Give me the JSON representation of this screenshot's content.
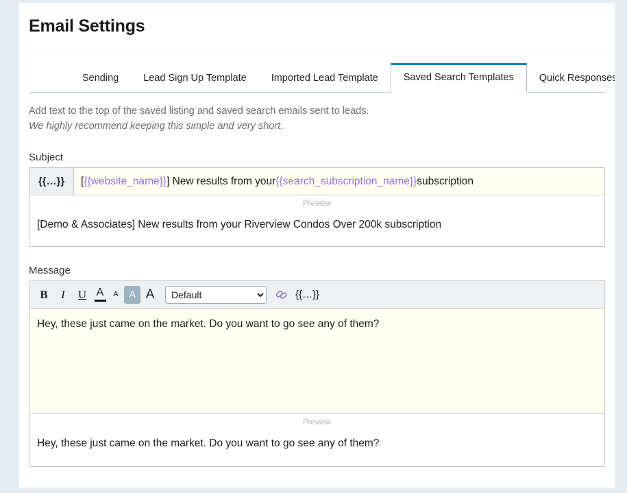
{
  "page": {
    "title": "Email Settings"
  },
  "tabs": [
    {
      "label": "Sending",
      "active": false
    },
    {
      "label": "Lead Sign Up Template",
      "active": false
    },
    {
      "label": "Imported Lead Template",
      "active": false
    },
    {
      "label": "Saved Search Templates",
      "active": true
    },
    {
      "label": "Quick Responses",
      "active": false
    }
  ],
  "description": {
    "line1": "Add text to the top of the saved listing and saved search emails sent to leads.",
    "line2": "We highly recommend keeping this simple and very short."
  },
  "subject": {
    "label": "Subject",
    "merge_button": "{{…}}",
    "value_parts": [
      {
        "text": "[",
        "token": false
      },
      {
        "text": "{{website_name}}",
        "token": true
      },
      {
        "text": "] New results from your ",
        "token": false
      },
      {
        "text": "{{search_subscription_name}}",
        "token": true
      },
      {
        "text": " subscription",
        "token": false
      }
    ],
    "preview_label": "Preview",
    "preview_value": "[Demo & Associates] New results from your Riverview Condos Over 200k subscription"
  },
  "message": {
    "label": "Message",
    "toolbar": {
      "bold": "B",
      "italic": "I",
      "underline": "U",
      "text_color": "A",
      "size_small": "A",
      "size_medium": "A",
      "size_large": "A",
      "font_select_value": "Default",
      "font_select_options": [
        "Default"
      ],
      "link_icon": "link-icon",
      "merge_button": "{{…}}"
    },
    "body_value": "Hey, these just came on the market. Do you want to go see any of them?",
    "preview_label": "Preview",
    "preview_value": "Hey, these just came on the market. Do you want to go see any of them?"
  },
  "colors": {
    "page_background": "#e7ecf0",
    "card_background": "#ffffff",
    "active_tab_accent": "#1a7fc1",
    "tab_border": "#a9bfcd",
    "merge_token": "#9b6fe0",
    "editable_field_background": "#fffff2",
    "toolbar_background": "#eef1f4",
    "selected_tool_background": "#9cb3c2"
  }
}
